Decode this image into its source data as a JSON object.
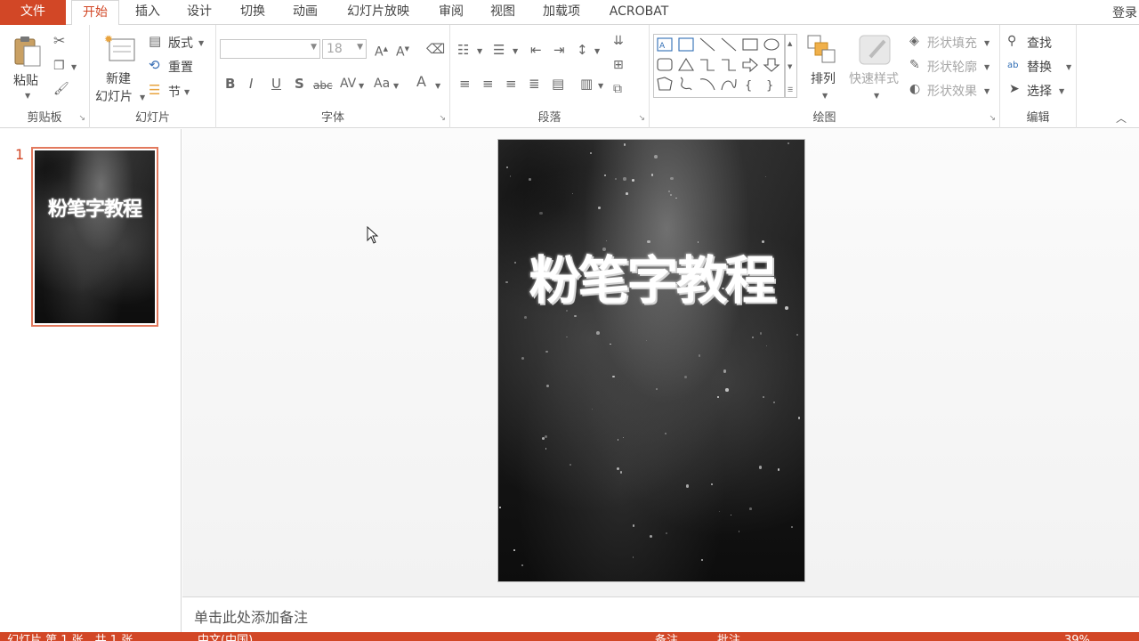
{
  "tabs": {
    "file": "文件",
    "items": [
      "开始",
      "插入",
      "设计",
      "切换",
      "动画",
      "幻灯片放映",
      "审阅",
      "视图",
      "加载项",
      "ACROBAT"
    ],
    "active_index": 0,
    "signin": "登录"
  },
  "ribbon": {
    "clipboard": {
      "label": "剪贴板",
      "paste": "粘贴"
    },
    "slides": {
      "label": "幻灯片",
      "new_slide_line1": "新建",
      "new_slide_line2": "幻灯片",
      "layout": "版式",
      "reset": "重置",
      "section": "节"
    },
    "font": {
      "label": "字体",
      "font_size": "18"
    },
    "paragraph": {
      "label": "段落"
    },
    "drawing": {
      "label": "绘图",
      "arrange": "排列",
      "quick_styles": "快速样式",
      "shape_fill": "形状填充",
      "shape_outline": "形状轮廓",
      "shape_effects": "形状效果"
    },
    "editing": {
      "label": "编辑",
      "find": "查找",
      "replace": "替换",
      "select": "选择"
    }
  },
  "thumbnails": [
    {
      "number": "1",
      "title": "粉笔字教程"
    }
  ],
  "slide": {
    "title": "粉笔字教程"
  },
  "notes": {
    "placeholder": "单击此处添加备注"
  },
  "status": {
    "slide_info": "幻灯片 第 1 张，共 1 张",
    "language": "中文(中国)",
    "notes_btn": "备注",
    "comments_btn": "批注",
    "zoom": "39%"
  },
  "colors": {
    "accent": "#d24726",
    "thumb_border": "#e2795d"
  }
}
